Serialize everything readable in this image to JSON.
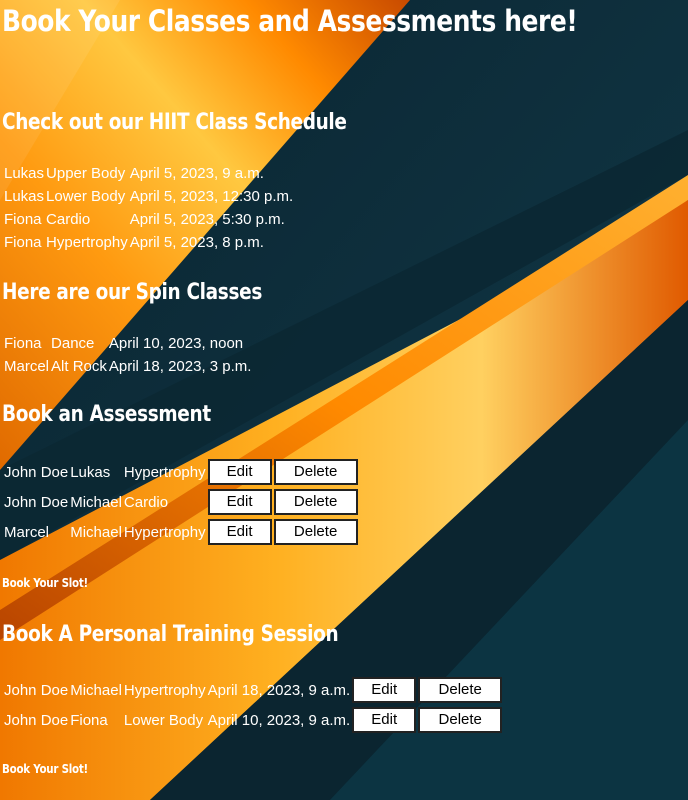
{
  "page_title": "Book Your Classes and Assessments here!",
  "hiit": {
    "heading": "Check out our HIIT Class Schedule",
    "rows": [
      [
        "Lukas",
        "Upper Body",
        "April 5, 2023, 9 a.m."
      ],
      [
        "Lukas",
        "Lower Body",
        "April 5, 2023, 12:30 p.m."
      ],
      [
        "Fiona",
        "Cardio",
        "April 5, 2023, 5:30 p.m."
      ],
      [
        "Fiona",
        "Hypertrophy",
        "April 5, 2023, 8 p.m."
      ]
    ]
  },
  "spin": {
    "heading": "Here are our Spin Classes",
    "rows": [
      [
        "Fiona",
        "Dance",
        "April 10, 2023, noon"
      ],
      [
        "Marcel",
        "Alt Rock",
        "April 18, 2023, 3 p.m."
      ]
    ]
  },
  "assessment": {
    "heading": "Book an Assessment",
    "rows": [
      [
        "John Doe",
        "Lukas",
        "Hypertrophy"
      ],
      [
        "John Doe",
        "Michael",
        "Cardio"
      ],
      [
        "Marcel",
        "Michael",
        "Hypertrophy"
      ]
    ],
    "book_label": "Book Your Slot!"
  },
  "pt": {
    "heading": "Book A Personal Training Session",
    "rows": [
      [
        "John Doe",
        "Michael",
        "Hypertrophy",
        "April 18, 2023, 9 a.m."
      ],
      [
        "John Doe",
        "Fiona",
        "Lower Body",
        "April 10, 2023, 9 a.m."
      ]
    ],
    "book_label": "Book Your Slot!"
  },
  "buttons": {
    "edit": "Edit",
    "delete": "Delete"
  },
  "colors": {
    "background": "#0d2a36",
    "accent": "#ff8a00",
    "text": "#ffffff"
  }
}
